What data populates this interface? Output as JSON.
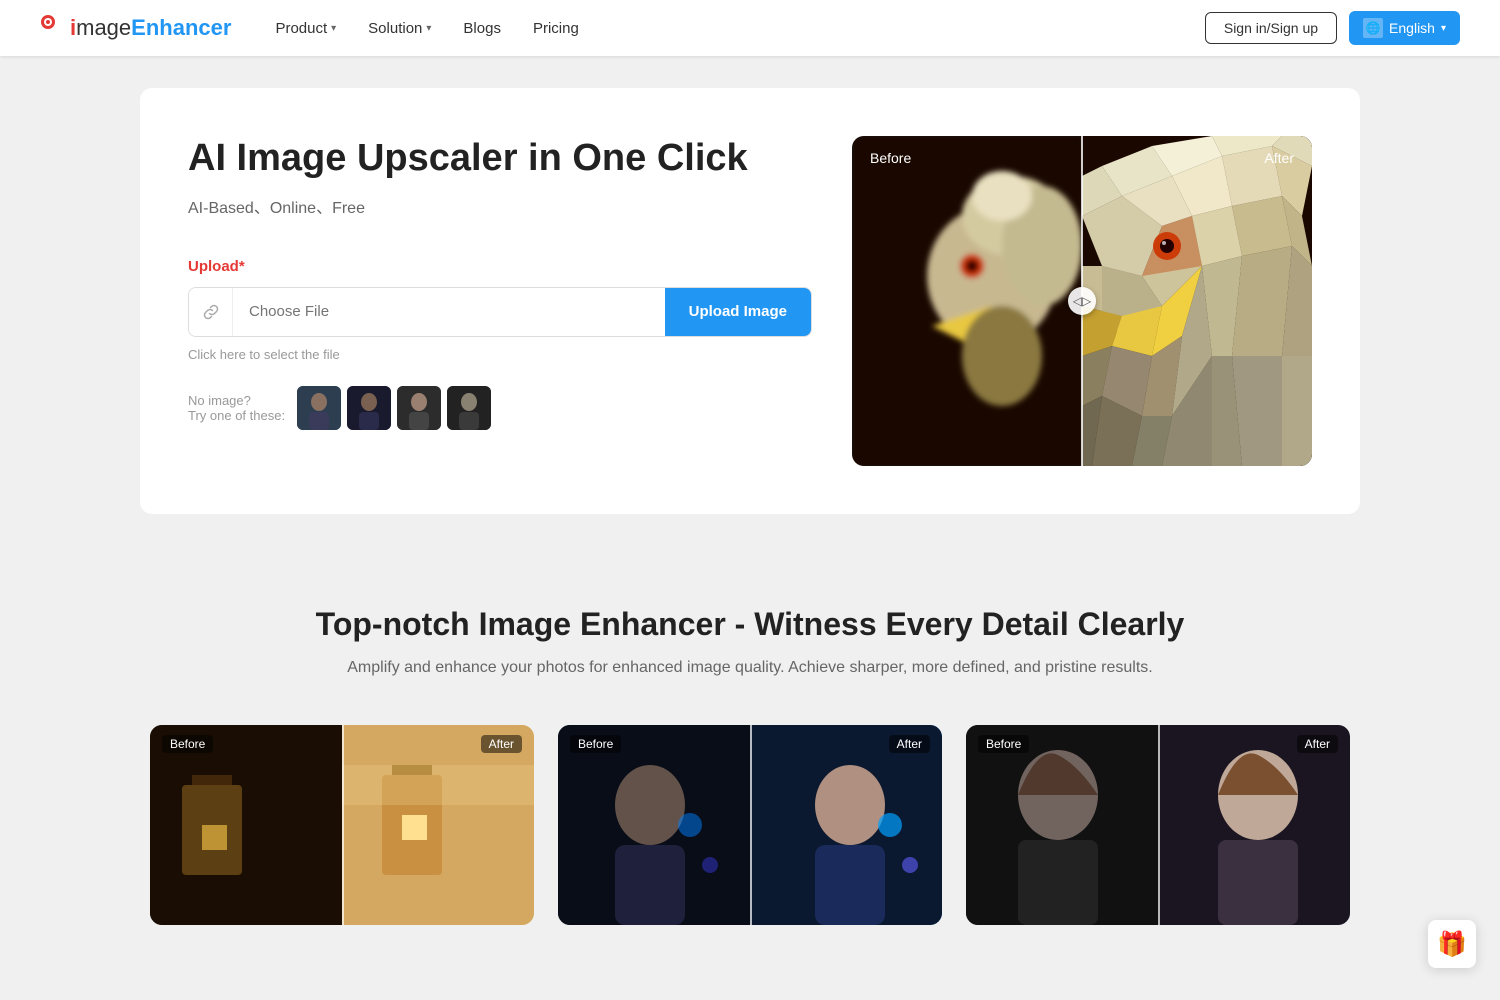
{
  "navbar": {
    "logo": {
      "i": "i",
      "mage": "mage ",
      "enhancer": "Enhancer"
    },
    "nav_items": [
      {
        "label": "Product",
        "has_dropdown": true
      },
      {
        "label": "Solution",
        "has_dropdown": true
      },
      {
        "label": "Blogs",
        "has_dropdown": false
      },
      {
        "label": "Pricing",
        "has_dropdown": false
      }
    ],
    "signin_label": "Sign in/Sign up",
    "lang_label": "English"
  },
  "hero": {
    "title": "AI Image Upscaler in One Click",
    "subtitle": "AI-Based、Online、Free",
    "upload_label": "Upload",
    "upload_required": "*",
    "choose_file_placeholder": "Choose File",
    "upload_btn_label": "Upload Image",
    "upload_hint": "Click here to select the file",
    "sample_label_line1": "No image?",
    "sample_label_line2": "Try one of these:",
    "comparison_before_label": "Before",
    "comparison_after_label": "After"
  },
  "bottom": {
    "title": "Top-notch Image Enhancer - Witness Every Detail Clearly",
    "subtitle": "Amplify and enhance your photos for enhanced image quality. Achieve sharper, more defined, and pristine results.",
    "cards": [
      {
        "before": "Before",
        "after": "After"
      },
      {
        "before": "Before",
        "after": "After"
      },
      {
        "before": "Before",
        "after": "After"
      }
    ]
  },
  "gift_btn": "🎁"
}
